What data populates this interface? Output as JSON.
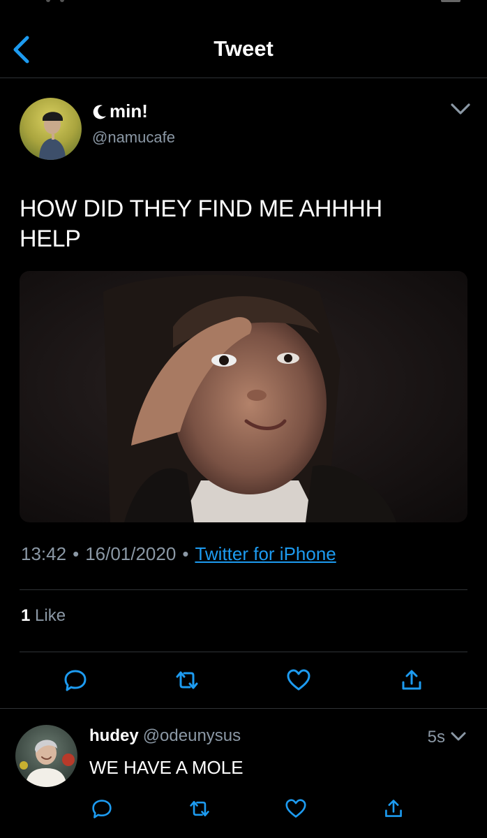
{
  "header": {
    "title": "Tweet"
  },
  "tweet": {
    "display_name": "min!",
    "handle": "@namucafe",
    "text_line1": "HOW DID THEY FIND ME AHHHH",
    "text_line2": "HELP",
    "time": "13:42",
    "date": "16/01/2020",
    "source": "Twitter for iPhone",
    "like_count": "1",
    "like_label": "Like"
  },
  "reply": {
    "display_name": "hudey",
    "handle": "@odeunysus",
    "time": "5s",
    "text": "WE HAVE A MOLE"
  },
  "colors": {
    "background": "#000000",
    "secondary_text": "#8b98a5",
    "link": "#1d9bf0",
    "divider": "#2f3336",
    "icon_accent": "#1d9bf0"
  },
  "icons": [
    "back-arrow-icon",
    "crescent-moon-icon",
    "chevron-down-icon",
    "reply-icon",
    "retweet-icon",
    "like-icon",
    "share-icon"
  ]
}
